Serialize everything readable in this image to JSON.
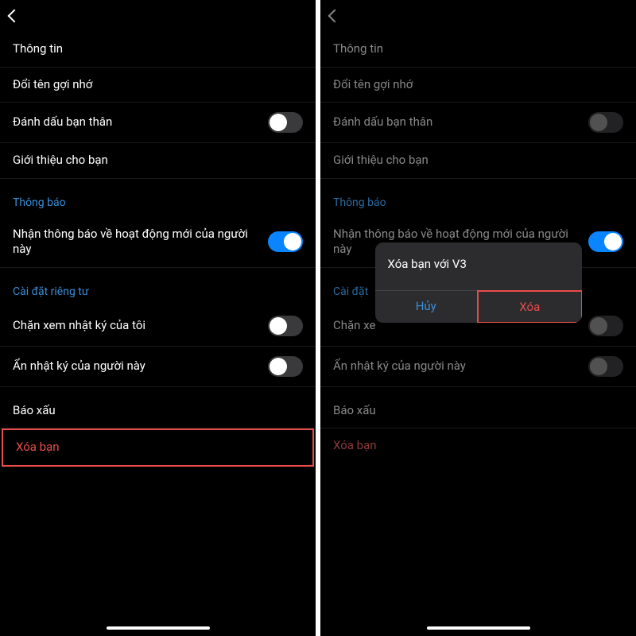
{
  "left": {
    "rows": {
      "info": "Thông tin",
      "rename": "Đổi tên gợi nhớ",
      "mark_close": "Đánh dấu bạn thân",
      "introduce": "Giới thiệu cho bạn"
    },
    "sections": {
      "notifications": "Thông báo",
      "privacy": "Cài đặt riêng tư"
    },
    "notif_row": "Nhận thông báo về hoạt động mới của người này",
    "privacy_rows": {
      "block_journal": "Chặn xem nhật ký của tôi",
      "hide_journal": "Ẩn nhật ký của người này"
    },
    "report": "Báo xấu",
    "delete": "Xóa bạn"
  },
  "right": {
    "rows": {
      "info": "Thông tin",
      "rename": "Đổi tên gợi nhớ",
      "mark_close": "Đánh dấu bạn thân",
      "introduce": "Giới thiệu cho bạn"
    },
    "sections": {
      "notifications": "Thông báo",
      "privacy_partial": "Cài đặt"
    },
    "notif_row": "Nhận thông báo về hoạt động mới của người này",
    "privacy_rows": {
      "block_journal_partial": "Chặn xe",
      "hide_journal_partial": "Ẩn nhật ký của người này"
    },
    "report": "Báo xấu",
    "delete": "Xóa bạn",
    "dialog": {
      "title": "Xóa bạn với V3",
      "cancel": "Hủy",
      "confirm": "Xóa"
    }
  }
}
